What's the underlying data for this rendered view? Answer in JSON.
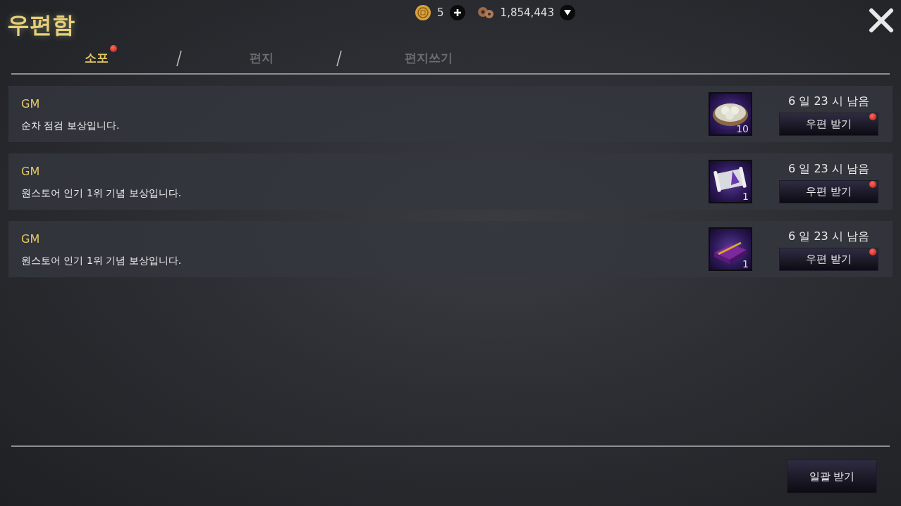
{
  "window": {
    "title": "우편함"
  },
  "currencies": [
    {
      "kind": "coin",
      "amount": "5",
      "button": {
        "kind": "plus"
      }
    },
    {
      "kind": "donut",
      "amount": "1,854,443",
      "button": {
        "kind": "down"
      }
    }
  ],
  "tabs": [
    {
      "label": "소포",
      "selected": true,
      "notify": true
    },
    {
      "label": "편지",
      "selected": false,
      "notify": false
    },
    {
      "label": "편지쓰기",
      "selected": false,
      "notify": false
    }
  ],
  "mails": [
    {
      "sender": "GM",
      "message": "순차 점검 보상입니다.",
      "item": {
        "kind": "dumplings",
        "count": "10"
      },
      "time_left": "6 일 23 시 남음",
      "button": "우편 받기",
      "notify": true
    },
    {
      "sender": "GM",
      "message": "원스토어 인기 1위 기념 보상입니다.",
      "item": {
        "kind": "scroll",
        "count": "1"
      },
      "time_left": "6 일 23 시 남음",
      "button": "우편 받기",
      "notify": true
    },
    {
      "sender": "GM",
      "message": "원스토어 인기 1위 기념 보상입니다.",
      "item": {
        "kind": "box",
        "count": "1"
      },
      "time_left": "6 일 23 시 남음",
      "button": "우편 받기",
      "notify": true
    }
  ],
  "bulk_button": "일괄 받기"
}
